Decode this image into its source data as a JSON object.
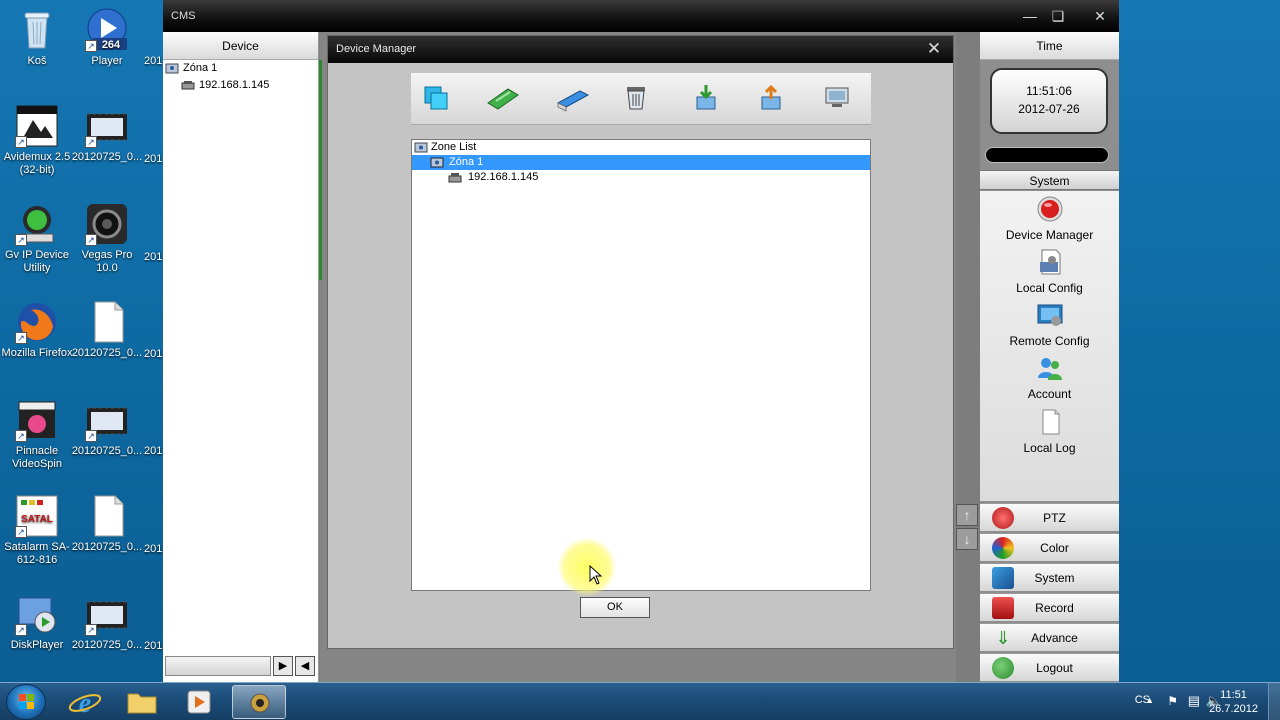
{
  "desktop": {
    "icons": [
      {
        "label": "Koš"
      },
      {
        "label": "Player"
      },
      {
        "label": "Avidemux 2.5 (32-bit)"
      },
      {
        "label": "20120725_0..."
      },
      {
        "label": "Gv IP Device Utility"
      },
      {
        "label": "Vegas Pro 10.0"
      },
      {
        "label": "Mozilla Firefox"
      },
      {
        "label": "20120725_0..."
      },
      {
        "label": "Pinnacle VideoSpin"
      },
      {
        "label": "20120725_0..."
      },
      {
        "label": "Satalarm SA-612-816"
      },
      {
        "label": "20120725_0..."
      },
      {
        "label": "DiskPlayer"
      },
      {
        "label": "20120725_0..."
      }
    ],
    "clipped_label": "201",
    "player_badge": "264",
    "satal_badge": "SATAL"
  },
  "cms": {
    "title": "CMS",
    "device_header": "Device",
    "time_header": "Time",
    "tree": [
      {
        "label": "Zóna 1"
      },
      {
        "label": "192.168.1.145"
      }
    ],
    "time": "11:51:06",
    "date": "2012-07-26",
    "system_header": "System",
    "system_items": [
      {
        "label": "Device Manager",
        "icon": "device-manager-icon"
      },
      {
        "label": "Local Config",
        "icon": "local-config-icon"
      },
      {
        "label": "Remote Config",
        "icon": "remote-config-icon"
      },
      {
        "label": "Account",
        "icon": "account-icon"
      },
      {
        "label": "Local Log",
        "icon": "local-log-icon"
      }
    ],
    "side_buttons": [
      {
        "label": "PTZ"
      },
      {
        "label": "Color"
      },
      {
        "label": "System"
      },
      {
        "label": "Record"
      },
      {
        "label": "Advance"
      },
      {
        "label": "Logout"
      }
    ]
  },
  "device_manager": {
    "title": "Device Manager",
    "toolbar": [
      {
        "icon": "add-zone-icon"
      },
      {
        "icon": "add-device-icon"
      },
      {
        "icon": "modify-icon"
      },
      {
        "icon": "delete-icon"
      },
      {
        "icon": "import-icon"
      },
      {
        "icon": "export-icon"
      },
      {
        "icon": "search-device-icon"
      }
    ],
    "list": [
      {
        "label": "Zone List"
      },
      {
        "label": "Zóna 1"
      },
      {
        "label": "192.168.1.145"
      }
    ],
    "ok_label": "OK"
  },
  "taskbar": {
    "language": "CS",
    "time": "11:51",
    "date": "26.7.2012"
  },
  "colors": {
    "selection": "#3399ff",
    "desktop": "#1577b4",
    "taskbar": "#1b4c78"
  }
}
